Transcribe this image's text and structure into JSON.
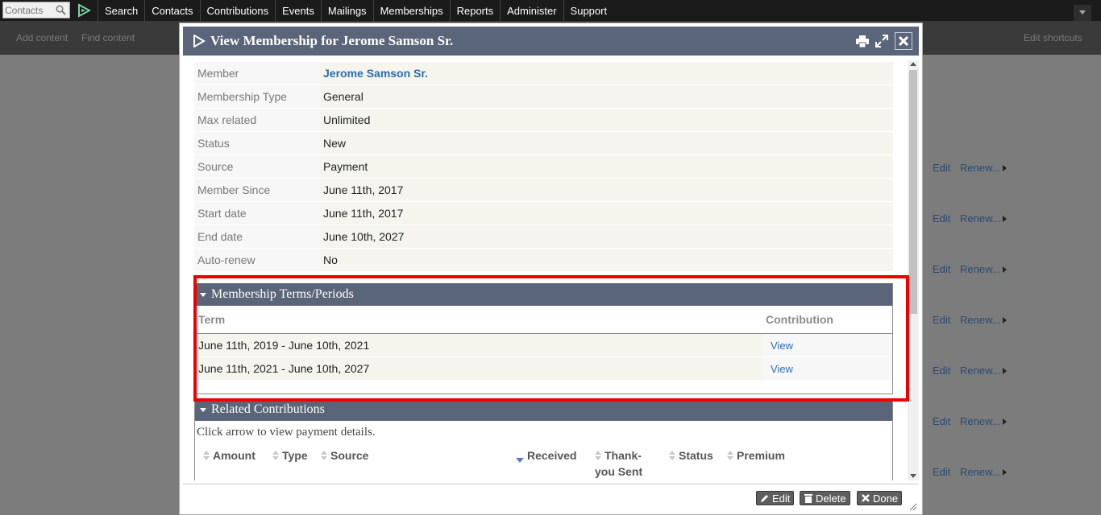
{
  "menu": {
    "search_placeholder": "Contacts",
    "items": [
      "Search",
      "Contacts",
      "Contributions",
      "Events",
      "Mailings",
      "Memberships",
      "Reports",
      "Administer",
      "Support"
    ]
  },
  "shortcuts": {
    "add": "Add content",
    "find": "Find content",
    "edit": "Edit shortcuts"
  },
  "bg_rows": {
    "edit": "Edit",
    "renew": "Renew..."
  },
  "dialog": {
    "title": "View Membership for Jerome Samson Sr.",
    "details": [
      {
        "label": "Member",
        "value": "Jerome Samson Sr."
      },
      {
        "label": "Membership Type",
        "value": "General"
      },
      {
        "label": "Max related",
        "value": "Unlimited"
      },
      {
        "label": "Status",
        "value": "New"
      },
      {
        "label": "Source",
        "value": "Payment"
      },
      {
        "label": "Member Since",
        "value": "June 11th, 2017"
      },
      {
        "label": "Start date",
        "value": "June 11th, 2017"
      },
      {
        "label": "End date",
        "value": "June 10th, 2027"
      },
      {
        "label": "Auto-renew",
        "value": "No"
      }
    ],
    "terms": {
      "heading": "Membership Terms/Periods",
      "col_term": "Term",
      "col_contribution": "Contribution",
      "rows": [
        {
          "term": "June 11th, 2019 - June 10th, 2021",
          "link": "View"
        },
        {
          "term": "June 11th, 2021 - June 10th, 2027",
          "link": "View"
        }
      ]
    },
    "contributions": {
      "heading": "Related Contributions",
      "hint": "Click arrow to view payment details.",
      "cols": {
        "amount": "Amount",
        "type": "Type",
        "source": "Source",
        "received": "Received",
        "thankyou_1": "Thank-",
        "thankyou_2": "you Sent",
        "status": "Status",
        "premium": "Premium"
      }
    },
    "buttons": {
      "edit": "Edit",
      "delete": "Delete",
      "done": "Done"
    }
  },
  "colors": {
    "header_bg": "#5b6579",
    "highlight": "#e00000",
    "link": "#2a6db0"
  }
}
